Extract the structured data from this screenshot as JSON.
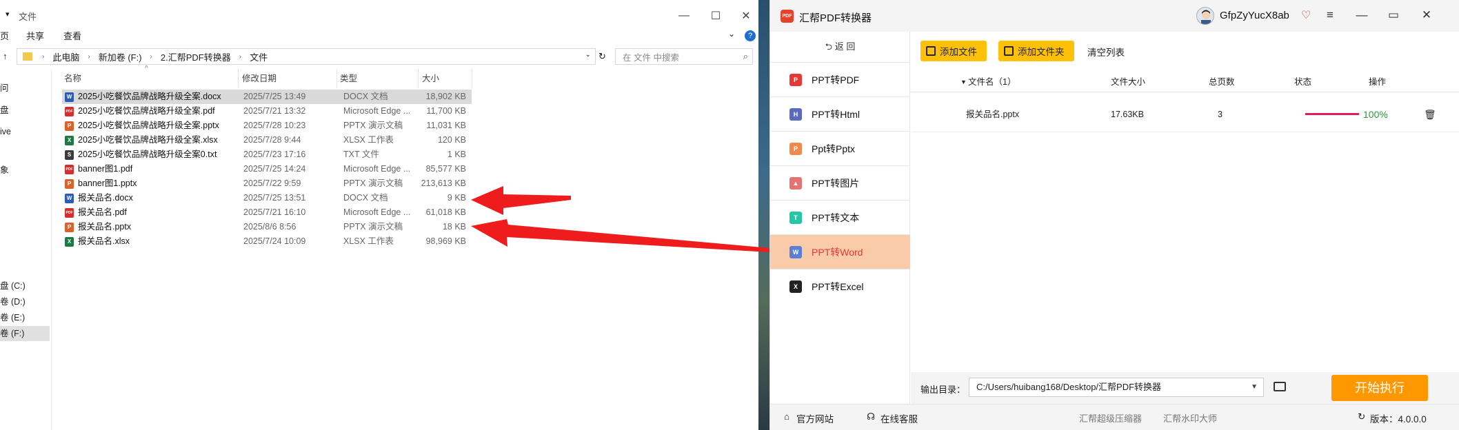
{
  "explorer": {
    "title": "文件",
    "ribbon": {
      "tab1": "页",
      "tab2": "共享",
      "tab3": "查看"
    },
    "breadcrumb": [
      "此电脑",
      "新加卷 (F:)",
      "2.汇帮PDF转换器",
      "文件"
    ],
    "search_placeholder": "在 文件 中搜索",
    "nav": [
      "问",
      "盘",
      "ive",
      "象",
      "盘 (C:)",
      "卷 (D:)",
      "卷 (E:)",
      "卷 (F:)"
    ],
    "columns": {
      "name": "名称",
      "date": "修改日期",
      "type": "类型",
      "size": "大小"
    },
    "files": [
      {
        "name": "2025小吃餐饮品牌战略升级全案.docx",
        "date": "2025/7/25 13:49",
        "type": "DOCX 文档",
        "size": "18,902 KB",
        "icon": "word-icon",
        "color": "#2b5bb7",
        "glyph": "W"
      },
      {
        "name": "2025小吃餐饮品牌战略升级全案.pdf",
        "date": "2025/7/21 13:32",
        "type": "Microsoft Edge ...",
        "size": "11,700 KB",
        "icon": "pdf-icon",
        "color": "#d32f2f",
        "glyph": "PDF"
      },
      {
        "name": "2025小吃餐饮品牌战略升级全案.pptx",
        "date": "2025/7/28 10:23",
        "type": "PPTX 演示文稿",
        "size": "11,031 KB",
        "icon": "ppt-icon",
        "color": "#d9632a",
        "glyph": "P"
      },
      {
        "name": "2025小吃餐饮品牌战略升级全案.xlsx",
        "date": "2025/7/28 9:44",
        "type": "XLSX 工作表",
        "size": "120 KB",
        "icon": "excel-icon",
        "color": "#1e7a43",
        "glyph": "X"
      },
      {
        "name": "2025小吃餐饮品牌战略升级全案0.txt",
        "date": "2025/7/23 17:16",
        "type": "TXT 文件",
        "size": "1 KB",
        "icon": "txt-icon",
        "color": "#3b3b3b",
        "glyph": "S"
      },
      {
        "name": "banner图1.pdf",
        "date": "2025/7/25 14:24",
        "type": "Microsoft Edge ...",
        "size": "85,577 KB",
        "icon": "pdf-icon",
        "color": "#d32f2f",
        "glyph": "PDF"
      },
      {
        "name": "banner图1.pptx",
        "date": "2025/7/22 9:59",
        "type": "PPTX 演示文稿",
        "size": "213,613 KB",
        "icon": "ppt-icon",
        "color": "#d9632a",
        "glyph": "P"
      },
      {
        "name": "报关品名.docx",
        "date": "2025/7/25 13:51",
        "type": "DOCX 文档",
        "size": "9 KB",
        "icon": "word-icon",
        "color": "#2b5bb7",
        "glyph": "W"
      },
      {
        "name": "报关品名.pdf",
        "date": "2025/7/21 16:10",
        "type": "Microsoft Edge ...",
        "size": "61,018 KB",
        "icon": "pdf-icon",
        "color": "#d32f2f",
        "glyph": "PDF"
      },
      {
        "name": "报关品名.pptx",
        "date": "2025/8/6 8:56",
        "type": "PPTX 演示文稿",
        "size": "18 KB",
        "icon": "ppt-icon",
        "color": "#d9632a",
        "glyph": "P"
      },
      {
        "name": "报关品名.xlsx",
        "date": "2025/7/24 10:09",
        "type": "XLSX 工作表",
        "size": "98,969 KB",
        "icon": "excel-icon",
        "color": "#1e7a43",
        "glyph": "X"
      }
    ]
  },
  "app": {
    "name": "汇帮PDF转换器",
    "user": "GfpZyYucX8ab",
    "back_label": "返 回",
    "menu": [
      {
        "label": "PPT转PDF",
        "icon": "pdf-icon",
        "color": "#e53935",
        "glyph": "P",
        "active": false
      },
      {
        "label": "PPT转Html",
        "icon": "html-icon",
        "color": "#5b6abf",
        "glyph": "H",
        "active": false
      },
      {
        "label": "Ppt转Pptx",
        "icon": "pptx-icon",
        "color": "#f08a4b",
        "glyph": "P",
        "active": false
      },
      {
        "label": "PPT转图片",
        "icon": "image-icon",
        "color": "#e57373",
        "glyph": "▲",
        "active": false
      },
      {
        "label": "PPT转文本",
        "icon": "text-icon",
        "color": "#26c6a6",
        "glyph": "T",
        "active": false
      },
      {
        "label": "PPT转Word",
        "icon": "word-icon",
        "color": "#5b7fd6",
        "glyph": "W",
        "active": true
      },
      {
        "label": "PPT转Excel",
        "icon": "excel-icon",
        "color": "#222222",
        "glyph": "X",
        "active": false
      }
    ],
    "toolbar": {
      "add_file": "添加文件",
      "add_folder": "添加文件夹",
      "clear": "清空列表"
    },
    "table": {
      "headers": {
        "name": "文件名（1）",
        "size": "文件大小",
        "pages": "总页数",
        "status": "状态",
        "action": "操作"
      },
      "rows": [
        {
          "name": "报关品名.pptx",
          "size": "17.63KB",
          "pages": "3",
          "progress_pct": 100,
          "status": "100%"
        }
      ]
    },
    "output": {
      "label": "输出目录：",
      "path": "C:/Users/huibang168/Desktop/汇帮PDF转换器"
    },
    "start_label": "开始执行",
    "footer": {
      "site": "官方网站",
      "service": "在线客服",
      "link1": "汇帮超级压缩器",
      "link2": "汇帮水印大师",
      "version": "版本：4.0.0.0"
    },
    "accent": "#ffc107",
    "start_color": "#ff9800",
    "active_color": "#e53935"
  }
}
